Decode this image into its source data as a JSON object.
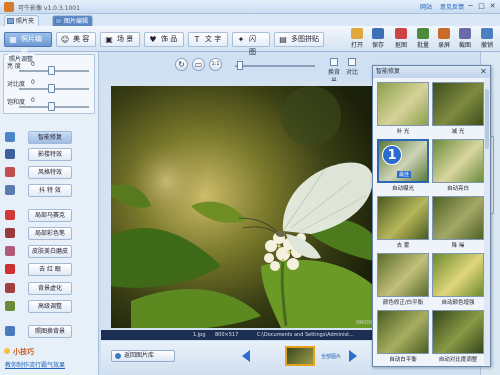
{
  "window": {
    "title": "可牛影像 v1.0.3.1001",
    "links": [
      "网站",
      "意见反馈"
    ],
    "controls": [
      "─",
      "□",
      "✕"
    ]
  },
  "mode_tabs": [
    {
      "label": "照片夹",
      "active": false
    },
    {
      "label": "图片编辑",
      "active": true
    }
  ],
  "toolbar": {
    "tools": [
      {
        "label": "照片编辑",
        "icon": "photo-edit-icon",
        "glyph": "▦",
        "active": true
      },
      {
        "label": "美 容",
        "icon": "beauty-icon",
        "glyph": "☺",
        "active": false
      },
      {
        "label": "场 景",
        "icon": "scene-icon",
        "glyph": "▣",
        "active": false
      },
      {
        "label": "饰 品",
        "icon": "accessory-icon",
        "glyph": "♥",
        "active": false
      },
      {
        "label": "文 字",
        "icon": "text-icon",
        "glyph": "T",
        "active": false
      },
      {
        "label": "闪 图",
        "icon": "flash-icon",
        "glyph": "✦",
        "active": false
      },
      {
        "label": "多图拼贴",
        "icon": "collage-icon",
        "glyph": "▤",
        "active": false
      }
    ],
    "right_tools": [
      {
        "label": "打开",
        "icon": "open-icon",
        "color": "#e0a73a"
      },
      {
        "label": "保存",
        "icon": "save-icon",
        "color": "#3f6fb6"
      },
      {
        "label": "抠图",
        "icon": "cutout-icon",
        "color": "#cc4444"
      },
      {
        "label": "批量",
        "icon": "batch-icon",
        "color": "#4a8a3a"
      },
      {
        "label": "录屏",
        "icon": "record-icon",
        "color": "#c86a28"
      },
      {
        "label": "截图",
        "icon": "screenshot-icon",
        "color": "#6a6aa8"
      },
      {
        "label": "撤销",
        "icon": "undo-icon",
        "color": "#4a7fc0"
      }
    ]
  },
  "adjust": {
    "title": "照片调整",
    "sliders": [
      {
        "label": "亮 度",
        "value": "0",
        "position": 0.45
      },
      {
        "label": "对比度",
        "value": "0",
        "position": 0.45
      },
      {
        "label": "饱和度",
        "value": "0",
        "position": 0.45
      }
    ]
  },
  "effects": [
    {
      "label": "智能修复",
      "icon": "smart-fix-icon",
      "color": "#4a86c8",
      "active": true
    },
    {
      "label": "影楼特效",
      "icon": "studio-effect-icon",
      "color": "#3a5f9a",
      "active": false
    },
    {
      "label": "风格特效",
      "icon": "style-effect-icon",
      "color": "#c05050",
      "active": false
    },
    {
      "label": "抖 特 效",
      "icon": "shake-effect-icon",
      "color": "#5a7ab0",
      "active": false
    },
    {
      "label": "局部马赛克",
      "icon": "mosaic-icon",
      "color": "#d03838",
      "active": false
    },
    {
      "label": "局部彩色笔",
      "icon": "color-brush-icon",
      "color": "#9a3a3a",
      "active": false
    },
    {
      "label": "皮肤美白磨皮",
      "icon": "skin-icon",
      "color": "#b05a7a",
      "active": false
    },
    {
      "label": "去 红 眼",
      "icon": "redeye-icon",
      "color": "#cc3030",
      "active": false
    },
    {
      "label": "背景虚化",
      "icon": "bg-blur-icon",
      "color": "#a04040",
      "active": false
    },
    {
      "label": "高级调整",
      "icon": "advanced-icon",
      "color": "#6a8a3a",
      "active": false
    },
    {
      "label": "照图换背景",
      "icon": "change-bg-icon",
      "color": "#4a7ac0",
      "active": false
    }
  ],
  "tip": {
    "title": "小技巧",
    "link": "教你制作流行霸气效果"
  },
  "view": {
    "rotate_label": "↻",
    "fit_label": "▭",
    "actual_label": "1:1",
    "small_tools": [
      {
        "label": "换背景"
      },
      {
        "label": "对比"
      }
    ]
  },
  "photo": {
    "watermark": "NIKON"
  },
  "status": {
    "file": "1.jpg",
    "dims": "800×517",
    "path": "C:\\Documents and Settings\\Administ..."
  },
  "bottom": {
    "back_label": "返回图片库",
    "thumb_label": "全部图片"
  },
  "popup": {
    "title": "智能修复",
    "presets": [
      {
        "label": "补 光",
        "colors": [
          "#8aa04a",
          "#d7d29a"
        ]
      },
      {
        "label": "减 光",
        "colors": [
          "#3e4e1c",
          "#7e8a40"
        ]
      },
      {
        "label": "自动曝光",
        "colors": [
          "#5a7a3a",
          "#cfd5b8"
        ],
        "selected": true,
        "badge": "1",
        "badge_label": "最佳"
      },
      {
        "label": "自动亮白",
        "colors": [
          "#6a8a3a",
          "#d8d6a0"
        ]
      },
      {
        "label": "去 雾",
        "colors": [
          "#4a5a1e",
          "#b6b65a"
        ]
      },
      {
        "label": "降 噪",
        "colors": [
          "#4e6226",
          "#a4a866"
        ]
      },
      {
        "label": "颜色修正/白平衡",
        "colors": [
          "#5a6c2c",
          "#c2c07a"
        ]
      },
      {
        "label": "自动颜色增强",
        "colors": [
          "#6c8a2e",
          "#e0d67a"
        ]
      },
      {
        "label": "自动白平衡",
        "colors": [
          "#4a5e22",
          "#a8ae60"
        ]
      },
      {
        "label": "自动对比度调整",
        "colors": [
          "#34461a",
          "#8a9a46"
        ]
      }
    ]
  }
}
